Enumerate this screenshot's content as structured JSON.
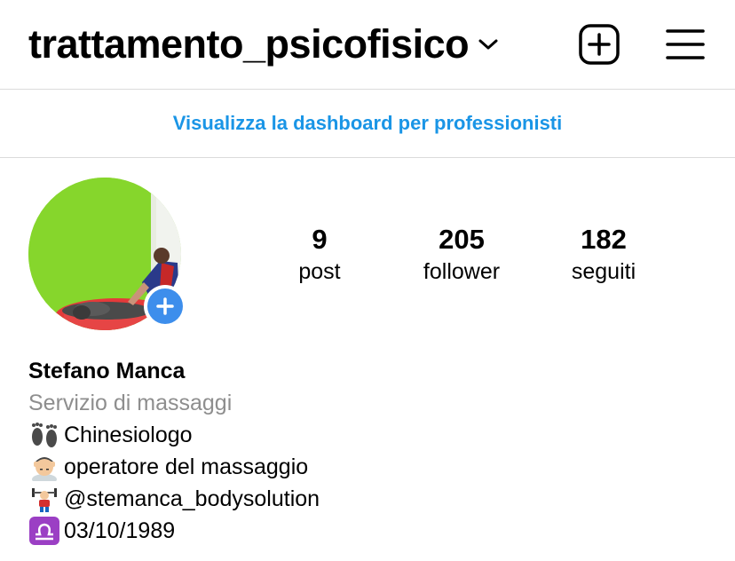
{
  "header": {
    "username": "trattamento_psicofisico",
    "chevron_icon": "chevron-down-icon",
    "create_icon": "plus-square-icon",
    "menu_icon": "hamburger-menu-icon"
  },
  "dashboard": {
    "link_text": "Visualizza la dashboard per professionisti",
    "color": "#1a95e6"
  },
  "profile": {
    "avatar_icon": "profile-photo",
    "add_story_icon": "plus-icon",
    "stats": [
      {
        "value": "9",
        "label": "post"
      },
      {
        "value": "205",
        "label": "follower"
      },
      {
        "value": "182",
        "label": "seguiti"
      }
    ]
  },
  "bio": {
    "name": "Stefano Manca",
    "category": "Servizio di massaggi",
    "lines": [
      {
        "icon": "footprints-emoji",
        "text": "Chinesiologo"
      },
      {
        "icon": "person-getting-massage-emoji",
        "text": "operatore del massaggio"
      },
      {
        "icon": "weightlifter-emoji",
        "text": " @stemanca_bodysolution"
      },
      {
        "icon": "libra-emoji",
        "text": " 03/10/1989"
      }
    ]
  },
  "colors": {
    "accent_blue": "#3d8eec",
    "secondary_text": "#8e8e8e",
    "divider": "#dbdbdb"
  }
}
